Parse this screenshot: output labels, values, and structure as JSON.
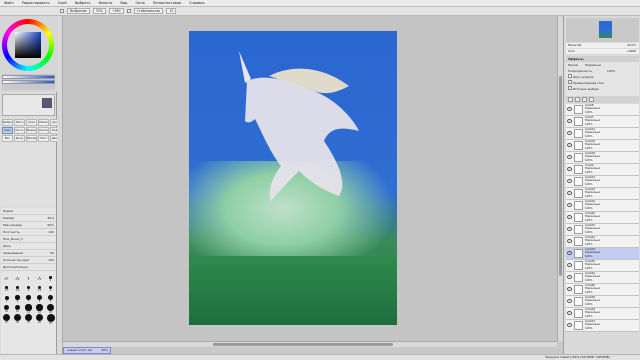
{
  "menu": [
    "Файл",
    "Редактировать",
    "Слой",
    "Выбрать",
    "Фильтр",
    "Вид",
    "Окно",
    "Пенопластовая",
    "Справка"
  ],
  "toolbar": {
    "selection_label": "Выбрание",
    "zoom_value": "33%",
    "angle_value": "+360",
    "stabilizer_label": "Стабилизатор",
    "stabilizer_value": "15"
  },
  "tools": [
    "Выбрать",
    "Лассо",
    "Лупа",
    "Пипетка",
    "Рука",
    "Перо",
    "Кисть",
    "Маркер",
    "Ластик",
    "Вода",
    "Blur",
    "Spray",
    "Blender",
    "Текст",
    "Двиг."
  ],
  "brush_props": [
    {
      "label": "Норма",
      "value": ""
    },
    {
      "label": "Размер",
      "value": "30.0"
    },
    {
      "label": "Мин размер",
      "value": "50%"
    },
    {
      "label": "Плотность",
      "value": "100"
    },
    {
      "label": "Pine_Brush_1",
      "value": ""
    },
    {
      "label": "(без)",
      "value": ""
    },
    {
      "label": "Смешивание",
      "value": "50"
    },
    {
      "label": "Количество цвет",
      "value": "100"
    },
    {
      "label": "Дополнительно",
      "value": ""
    }
  ],
  "brush_sizes": [
    "0.7",
    "0.8",
    "1",
    "1.5",
    "2",
    "2.3",
    "2.6",
    "3",
    "3.5",
    "4",
    "5",
    "6",
    "7",
    "8",
    "9",
    "10",
    "12",
    "14",
    "16",
    "20",
    "25",
    "30",
    "35",
    "40",
    "50"
  ],
  "navigator": {
    "zoom_label": "Масштаб",
    "zoom_value": "20.0%",
    "angle_label": "Угол",
    "angle_value": "+0008"
  },
  "layer_panel": {
    "effects_label": "Эффекты",
    "mode_label": "Режим",
    "mode_value": "Нормально",
    "opacity_label": "Непрозрачность",
    "opacity_value": "100%",
    "protect_label": "Фикс непрозр.",
    "clip_label": "Прикрепленная слоя",
    "source_label": "Источник выбора"
  },
  "layers": [
    {
      "name": "Слой8",
      "mode": "Нормально",
      "opacity": "100%",
      "selected": false
    },
    {
      "name": "Слой7",
      "mode": "Нормально",
      "opacity": "100%",
      "selected": false
    },
    {
      "name": "Слой14",
      "mode": "Нормально",
      "opacity": "100%",
      "selected": false
    },
    {
      "name": "Слой10",
      "mode": "Нормально",
      "opacity": "100%",
      "selected": false
    },
    {
      "name": "Слой18",
      "mode": "Нормально",
      "opacity": "100%",
      "selected": false
    },
    {
      "name": "Слой9",
      "mode": "Нормально",
      "opacity": "100%",
      "selected": false
    },
    {
      "name": "Слой13",
      "mode": "Нормально",
      "opacity": "100%",
      "selected": false
    },
    {
      "name": "Слой19",
      "mode": "Нормально",
      "opacity": "100%",
      "selected": false
    },
    {
      "name": "Слой16",
      "mode": "Нормально",
      "opacity": "100%",
      "selected": false
    },
    {
      "name": "Слой20",
      "mode": "Нормально",
      "opacity": "100%",
      "selected": false
    },
    {
      "name": "Слой15",
      "mode": "Нормально",
      "opacity": "100%",
      "selected": false
    },
    {
      "name": "Слой21",
      "mode": "Нормально",
      "opacity": "100%",
      "selected": false
    },
    {
      "name": "Слой23",
      "mode": "Нормально",
      "opacity": "100%",
      "selected": true
    },
    {
      "name": "Слой25",
      "mode": "Нормально",
      "opacity": "100%",
      "selected": false
    },
    {
      "name": "Слой24",
      "mode": "Нормально",
      "opacity": "100%",
      "selected": false
    },
    {
      "name": "Слой26",
      "mode": "Нормально",
      "opacity": "100%",
      "selected": false
    },
    {
      "name": "Слой28",
      "mode": "Нормально",
      "opacity": "100%",
      "selected": false
    },
    {
      "name": "Слой29",
      "mode": "Нормально",
      "opacity": "100%",
      "selected": false
    },
    {
      "name": "Слой27",
      "mode": "Нормально",
      "opacity": "100%",
      "selected": false
    }
  ],
  "canvas_tab": "новый холст.sai",
  "canvas_tab_zoom": "20%",
  "status": "Загрузка памяти 82% (3279МБ / 3953МБ)",
  "colors": {
    "primary": "#565a7e",
    "canvas_bg": "#2a67d1",
    "selected_layer": "#c5ccf2"
  }
}
